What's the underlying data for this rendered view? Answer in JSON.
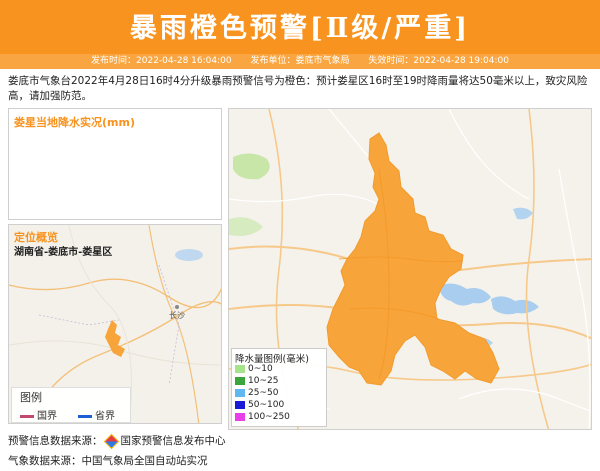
{
  "header": {
    "title": "暴雨橙色预警[Ⅱ级/严重]",
    "publish_time": "发布时间：2022-04-28 16:04:00",
    "publisher": "发布单位：娄底市气象局",
    "expire_time": "失效时间：2022-04-28 19:04:00"
  },
  "description": "娄底市气象台2022年4月28日16时4分升级暴雨预警信号为橙色：预计娄星区16时至19时降雨量将达50毫米以上，致灾风险高，请加强防范。",
  "rain_panel": {
    "title": "娄星当地降水实况(mm)"
  },
  "location_panel": {
    "title": "定位概览",
    "region": "湖南省-娄底市-娄星区",
    "city_label": "长沙",
    "legend": {
      "title": "图例",
      "items": [
        {
          "label": "国界",
          "color": "#c2496b"
        },
        {
          "label": "省界",
          "color": "#1f5fd6"
        }
      ]
    }
  },
  "main_map": {
    "warning_color": "#f7a43a",
    "legend": {
      "title": "降水量图例(毫米)",
      "items": [
        {
          "label": "0~10",
          "color": "#a6e48c"
        },
        {
          "label": "10~25",
          "color": "#3aa53a"
        },
        {
          "label": "25~50",
          "color": "#5fb8f0"
        },
        {
          "label": "50~100",
          "color": "#1a1ad6"
        },
        {
          "label": "100~250",
          "color": "#e83fe8"
        }
      ]
    }
  },
  "footer": {
    "source_label": "预警信息数据来源：",
    "source_name": "国家预警信息发布中心",
    "weather_label": "气象数据来源：中国气象局全国自动站实况"
  },
  "colors": {
    "accent": "#f7931e",
    "banner_sub": "#f9a642"
  }
}
